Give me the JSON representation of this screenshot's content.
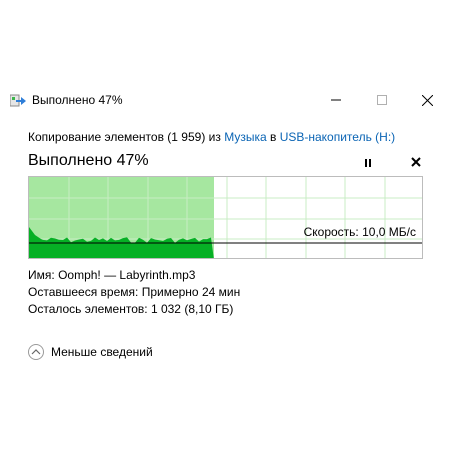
{
  "window": {
    "title": "Выполнено 47%",
    "icon": "copy-arrow-icon",
    "buttons": {
      "minimize": "minimize-icon",
      "maximize": "maximize-icon",
      "close": "close-icon"
    }
  },
  "copy": {
    "prefix": "Копирование элементов (1 959) из ",
    "source": "Музыка",
    "middle": " в ",
    "destination": "USB-накопитель (H:)"
  },
  "progress": {
    "heading": "Выполнено 47%",
    "fraction": 0.47,
    "speed_label": "Скорость: 10,0 МБ/с",
    "pause_icon": "pause-icon",
    "cancel_icon": "close-icon"
  },
  "details": {
    "name_label": "Имя:",
    "name_value": "Oomph! — Labyrinth.mp3",
    "time_label": "Оставшееся время:",
    "time_value": "Примерно 24 мин",
    "items_label": "Осталось элементов:",
    "items_value": "1 032 (8,10 ГБ)"
  },
  "footer": {
    "less_details": "Меньше сведений",
    "less_icon": "chevron-up-icon"
  },
  "colors": {
    "graph_fill_light": "#a6e7a0",
    "graph_fill_dark": "#06b025",
    "graph_grid": "#c8ecc4",
    "link": "#0a64b4"
  }
}
